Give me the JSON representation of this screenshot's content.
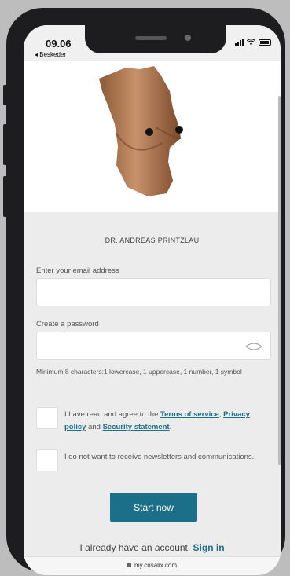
{
  "status": {
    "time": "09.06",
    "back_label": "Beskeder"
  },
  "clinic_name": "DR. ANDREAS PRINTZLAU",
  "email": {
    "label": "Enter your email address",
    "value": ""
  },
  "password": {
    "label": "Create a password",
    "value": "",
    "hint": "Minimum 8 characters:1 lowercase, 1 uppercase, 1 number, 1 symbol"
  },
  "terms": {
    "prefix": "I have read and agree to the ",
    "terms_link": "Terms of service",
    "comma": ",",
    "privacy_link": "Privacy policy",
    "and": " and ",
    "security_link": "Security statement",
    "suffix": ".",
    "checked": false
  },
  "newsletter": {
    "text": "I do not want to receive newsletters and communications.",
    "checked": false
  },
  "start_button": "Start now",
  "signin": {
    "prefix": "I already have an account. ",
    "link": "Sign in"
  },
  "url": "my.crisalix.com",
  "colors": {
    "accent": "#1b6f88",
    "link": "#1e6f8a"
  }
}
